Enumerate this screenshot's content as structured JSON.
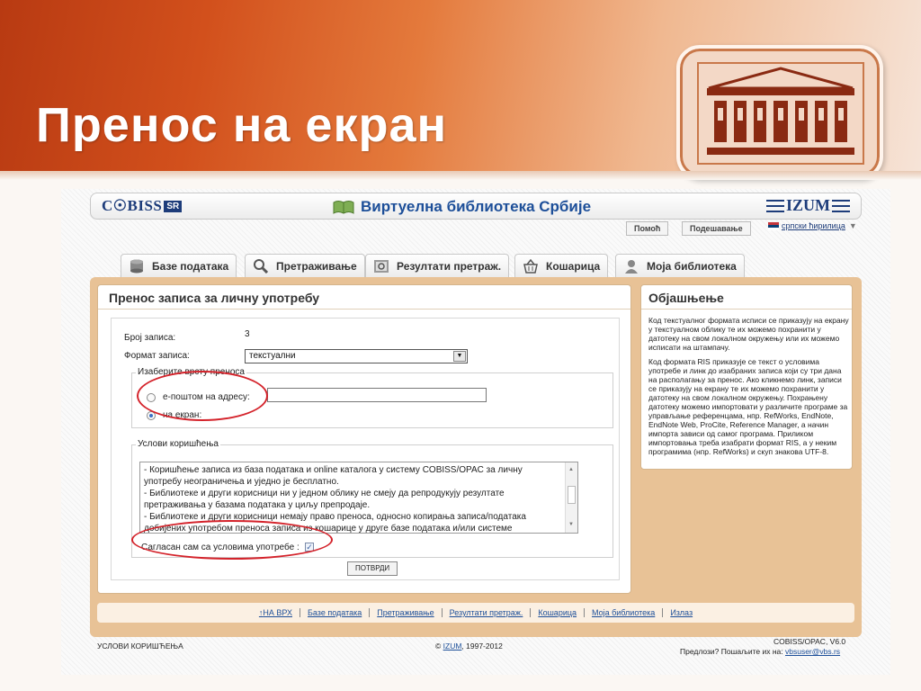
{
  "slide": {
    "title": "Пренос на екран"
  },
  "header": {
    "cobiss_logo": "C☉BISS",
    "cobiss_country": "SR",
    "site_title": "Виртуелна библиотека Србије",
    "izum_logo": "IZUM"
  },
  "toolbar": {
    "help": "Помоћ",
    "settings": "Подешавање",
    "language": "српски ћирилица"
  },
  "tabs": [
    {
      "label": "Базе података",
      "icon": "database-icon"
    },
    {
      "label": "Претраживање",
      "icon": "search-icon"
    },
    {
      "label": "Резултати претраж.",
      "icon": "results-icon"
    },
    {
      "label": "Кошарица",
      "icon": "basket-icon"
    },
    {
      "label": "Моја библиотека",
      "icon": "user-icon"
    }
  ],
  "transfer": {
    "heading": "Пренос записа за личну употребу",
    "count_label": "Број записа:",
    "count_value": "3",
    "format_label": "Формат записа:",
    "format_value": "текстуални",
    "method_legend": "Изаберите врсту преноса",
    "email_option": "е-поштом на адресу:",
    "email_value": "",
    "screen_option": "на екран:",
    "selected_method": "screen",
    "terms_legend": "Услови коришћења",
    "terms_lines": [
      "- Коришћење записа из база података и online каталога у систему COBISS/OPAC за личну",
      "употребу неограничења и уједно је бесплатно.",
      "- Библиотеке и други корисници ни у једном облику не смеју да репродукују резултате",
      "претраживања у базама података у циљу препродаје.",
      "- Библиотеке и други корисници немају право преноса, односно копирања записа/података",
      "добијених употребом преноса записа из кошарице у друге базе података и/или системе"
    ],
    "agree_label": "Сагласан сам са условима употребе :",
    "agree_checked": true,
    "confirm_button": "ПОТВРДИ"
  },
  "explanation": {
    "heading": "Објашњење",
    "paragraph1": "Код текстуалног формата исписи се приказују на екрану у текстуалном облику те их можемо похранити у датотеку на свом локалном окружењу или их можемо исписати на штампачу.",
    "paragraph2": "Код формата RIS приказује се текст о условима употребе и линк до изабраних записа који су три дана на располагању за пренос. Ако кликнемо линк, записи се приказују на екрану те их можемо похранити у датотеку на свом локалном окружењу. Похрањену датотеку можемо импортовати у различите програме за управљање референцама, нпр. RefWorks, EndNote, EndNote Web, ProCite, Reference Manager, а начин импорта зависи од самог програма. Приликом импортовања треба изабрати формат RIS, а у неким програмима (нпр. RefWorks) и скуп знакова UTF-8."
  },
  "footer_links": [
    "НА ВРХ",
    "Базе података",
    "Претраживање",
    "Резултати претраж.",
    "Кошарица",
    "Моја библиотека",
    "Излаз"
  ],
  "bottom": {
    "terms_link": "УСЛОВИ КОРИШЋЕЊА",
    "copyright_prefix": "©",
    "copyright_link": "IZUM",
    "copyright_years": ", 1997-2012",
    "version": "COBISS/OPAC, V6.0",
    "suggestions": "Предлози? Пошаљите их на:",
    "email_link": "vbsuser@vbs.rs"
  },
  "colors": {
    "accent_red": "#d4232b",
    "brand_blue": "#1d4f99",
    "frame_tan": "#e8c296"
  }
}
